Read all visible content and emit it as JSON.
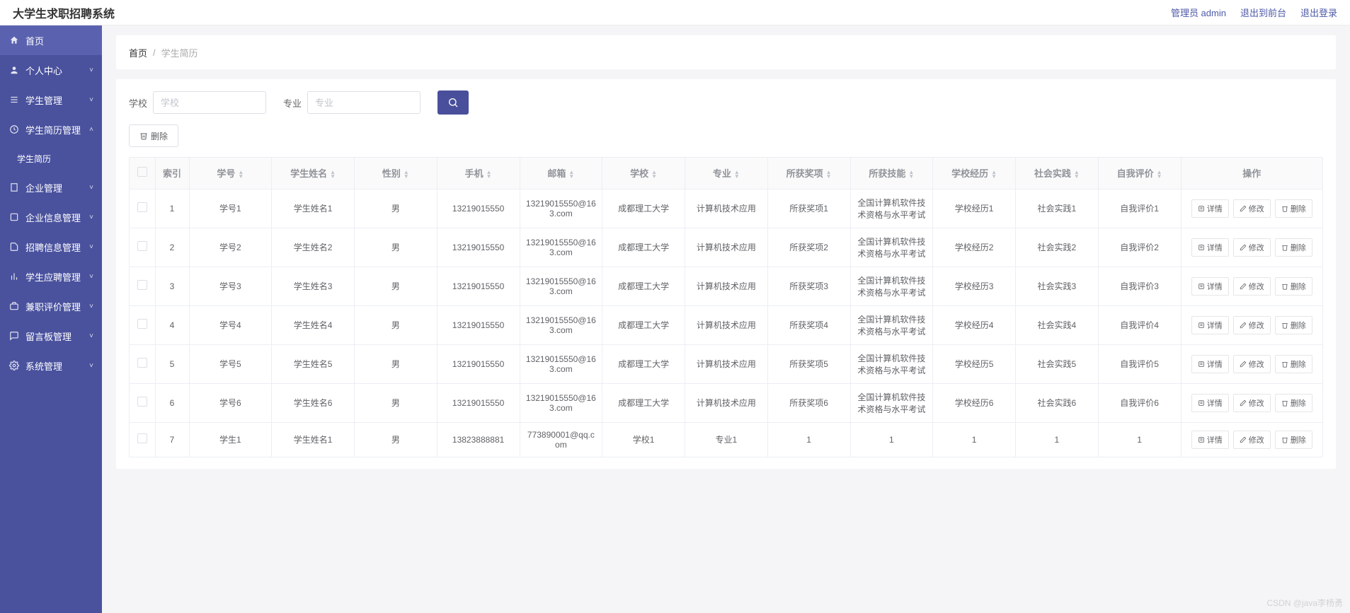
{
  "header": {
    "title": "大学生求职招聘系统",
    "admin_link": "管理员 admin",
    "front_link": "退出到前台",
    "logout_link": "退出登录"
  },
  "sidebar": {
    "items": [
      {
        "icon": "home",
        "label": "首页",
        "type": "home"
      },
      {
        "icon": "user",
        "label": "个人中心",
        "chevron": "down"
      },
      {
        "icon": "list",
        "label": "学生管理",
        "chevron": "down"
      },
      {
        "icon": "clock",
        "label": "学生简历管理",
        "chevron": "up"
      },
      {
        "icon": "",
        "label": "学生简历",
        "type": "sub"
      },
      {
        "icon": "building",
        "label": "企业管理",
        "chevron": "down"
      },
      {
        "icon": "info",
        "label": "企业信息管理",
        "chevron": "down"
      },
      {
        "icon": "doc",
        "label": "招聘信息管理",
        "chevron": "down"
      },
      {
        "icon": "chart",
        "label": "学生应聘管理",
        "chevron": "down"
      },
      {
        "icon": "briefcase",
        "label": "兼职评价管理",
        "chevron": "down"
      },
      {
        "icon": "message",
        "label": "留言板管理",
        "chevron": "down"
      },
      {
        "icon": "gear",
        "label": "系统管理",
        "chevron": "down"
      }
    ]
  },
  "breadcrumb": {
    "home": "首页",
    "current": "学生简历"
  },
  "filters": {
    "school_label": "学校",
    "school_placeholder": "学校",
    "major_label": "专业",
    "major_placeholder": "专业"
  },
  "toolbar": {
    "delete_label": "删除"
  },
  "table": {
    "columns": [
      "索引",
      "学号",
      "学生姓名",
      "性别",
      "手机",
      "邮箱",
      "学校",
      "专业",
      "所获奖项",
      "所获技能",
      "学校经历",
      "社会实践",
      "自我评价",
      "操作"
    ],
    "actions": {
      "detail": "详情",
      "edit": "修改",
      "delete": "删除"
    },
    "rows": [
      {
        "idx": "1",
        "sid": "学号1",
        "name": "学生姓名1",
        "gender": "男",
        "phone": "13219015550",
        "email": "13219015550@163.com",
        "school": "成都理工大学",
        "major": "计算机技术应用",
        "award": "所获奖项1",
        "skill": "全国计算机软件技术资格与水平考试",
        "edu": "学校经历1",
        "practice": "社会实践1",
        "eval": "自我评价1"
      },
      {
        "idx": "2",
        "sid": "学号2",
        "name": "学生姓名2",
        "gender": "男",
        "phone": "13219015550",
        "email": "13219015550@163.com",
        "school": "成都理工大学",
        "major": "计算机技术应用",
        "award": "所获奖项2",
        "skill": "全国计算机软件技术资格与水平考试",
        "edu": "学校经历2",
        "practice": "社会实践2",
        "eval": "自我评价2"
      },
      {
        "idx": "3",
        "sid": "学号3",
        "name": "学生姓名3",
        "gender": "男",
        "phone": "13219015550",
        "email": "13219015550@163.com",
        "school": "成都理工大学",
        "major": "计算机技术应用",
        "award": "所获奖项3",
        "skill": "全国计算机软件技术资格与水平考试",
        "edu": "学校经历3",
        "practice": "社会实践3",
        "eval": "自我评价3"
      },
      {
        "idx": "4",
        "sid": "学号4",
        "name": "学生姓名4",
        "gender": "男",
        "phone": "13219015550",
        "email": "13219015550@163.com",
        "school": "成都理工大学",
        "major": "计算机技术应用",
        "award": "所获奖项4",
        "skill": "全国计算机软件技术资格与水平考试",
        "edu": "学校经历4",
        "practice": "社会实践4",
        "eval": "自我评价4"
      },
      {
        "idx": "5",
        "sid": "学号5",
        "name": "学生姓名5",
        "gender": "男",
        "phone": "13219015550",
        "email": "13219015550@163.com",
        "school": "成都理工大学",
        "major": "计算机技术应用",
        "award": "所获奖项5",
        "skill": "全国计算机软件技术资格与水平考试",
        "edu": "学校经历5",
        "practice": "社会实践5",
        "eval": "自我评价5"
      },
      {
        "idx": "6",
        "sid": "学号6",
        "name": "学生姓名6",
        "gender": "男",
        "phone": "13219015550",
        "email": "13219015550@163.com",
        "school": "成都理工大学",
        "major": "计算机技术应用",
        "award": "所获奖项6",
        "skill": "全国计算机软件技术资格与水平考试",
        "edu": "学校经历6",
        "practice": "社会实践6",
        "eval": "自我评价6"
      },
      {
        "idx": "7",
        "sid": "学生1",
        "name": "学生姓名1",
        "gender": "男",
        "phone": "13823888881",
        "email": "773890001@qq.com",
        "school": "学校1",
        "major": "专业1",
        "award": "1",
        "skill": "1",
        "edu": "1",
        "practice": "1",
        "eval": "1"
      }
    ]
  },
  "watermark": "CSDN @java李杨勇"
}
